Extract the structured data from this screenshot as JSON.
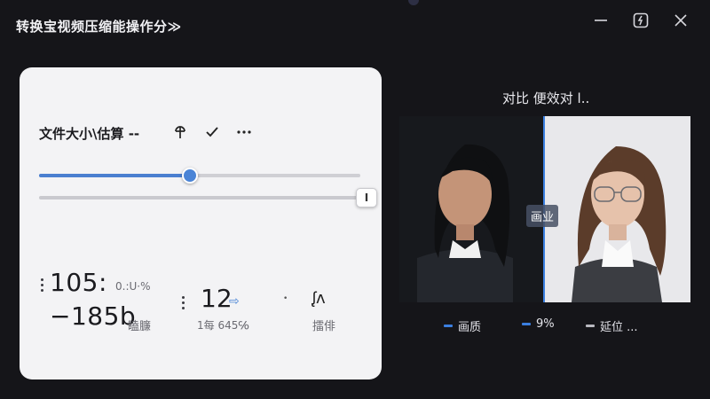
{
  "window": {
    "title": "转换宝视频压缩能操作分",
    "title_chevron": "≫",
    "minimize_glyph": "—",
    "restore_glyph": "⧉",
    "close_glyph": "✕"
  },
  "card": {
    "title": "文件大小\\估算 --",
    "tools": {
      "pin_glyph": "⚲",
      "check_glyph": "✓",
      "more_glyph": "···"
    },
    "slider1": {
      "value_fraction": 0.47
    },
    "slider2": {
      "thumb_label": "I"
    },
    "stats": {
      "left_big": "105:",
      "left_small": "0.:U·%",
      "left_delta": "−185b",
      "left_unit": "瞌臁",
      "mid_big": "12",
      "mid_arrow": "⇨",
      "mid_small": "1每 645℅",
      "mid_dot": "•",
      "right_icon": "ᶘᴧ",
      "right_label": "擂俳"
    }
  },
  "compare": {
    "title": "对比 便效对 l..",
    "divider_label": "画业",
    "legend": [
      {
        "label": "画质",
        "color": "#3b7fe0"
      },
      {
        "label": "9%",
        "color": "#3b7fe0"
      },
      {
        "label": "延位 ...",
        "color": "#b9b9c0"
      }
    ]
  }
}
